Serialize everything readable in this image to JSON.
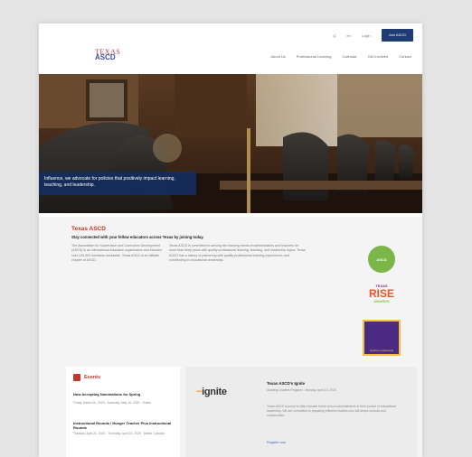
{
  "util_nav": {
    "link1": "Q",
    "link2": "en",
    "link3": "Login",
    "button": "Join ASCD"
  },
  "logo": {
    "line1": "TEXAS",
    "line2": "ASCD"
  },
  "nav": [
    "About Us",
    "Professional Learning",
    "Calendar",
    "Get Involved",
    "Contact"
  ],
  "hero": {
    "caption": "Influence, we advocate for policies that positively impact learning, teaching, and leadership."
  },
  "intro": {
    "title": "Texas ASCD",
    "subtitle": "Stay connected with your fellow educators across Texas by joining today.",
    "para1": "The Association for Supervision and Curriculum Development (ASCD) is an international education organization and includes over 125,000 members worldwide. Texas ASCD is an affiliate chapter of ASCD.",
    "para2": "Texas ASCD is committed to serving the learning needs of administrators and teachers for more than thirty years with quality professional learning, teaching, and leadership topics. Texas ASCD has a history of partnering with quality professional learning experiences and contributing to educational leadership.",
    "badge1": "ASCD",
    "badge2_top": "TEXAS",
    "badge2_mid": "RISE",
    "badge2_bot": "AWARDS",
    "badge3": "Teacher Leadership"
  },
  "events": {
    "heading": "Events",
    "e1_title": "Now Accepting Nominations for Spring",
    "e1_meta": "Friday, March 20, 2020 - Saturday, May 16, 2020 · Online",
    "e2_title": "Instructional Rounds / Hunger Teacher Plus Instructional Rounds",
    "e2_meta": "Tuesday, April 21, 2020 - Thursday, April 23, 2020 · Dallas, Canada"
  },
  "promo": {
    "logo_pre": "~",
    "logo_word": "ignite",
    "title": "Texas ASCD's Ignite",
    "meta": "Aspiring Leaders Program · Monday, April 13, 2020",
    "body": "Texas ASCD is proud to help educate future school administrators in their pursuit of educational leadership. We are committed to preparing effective leaders who will shape schools and communities.",
    "link": "Register now"
  }
}
